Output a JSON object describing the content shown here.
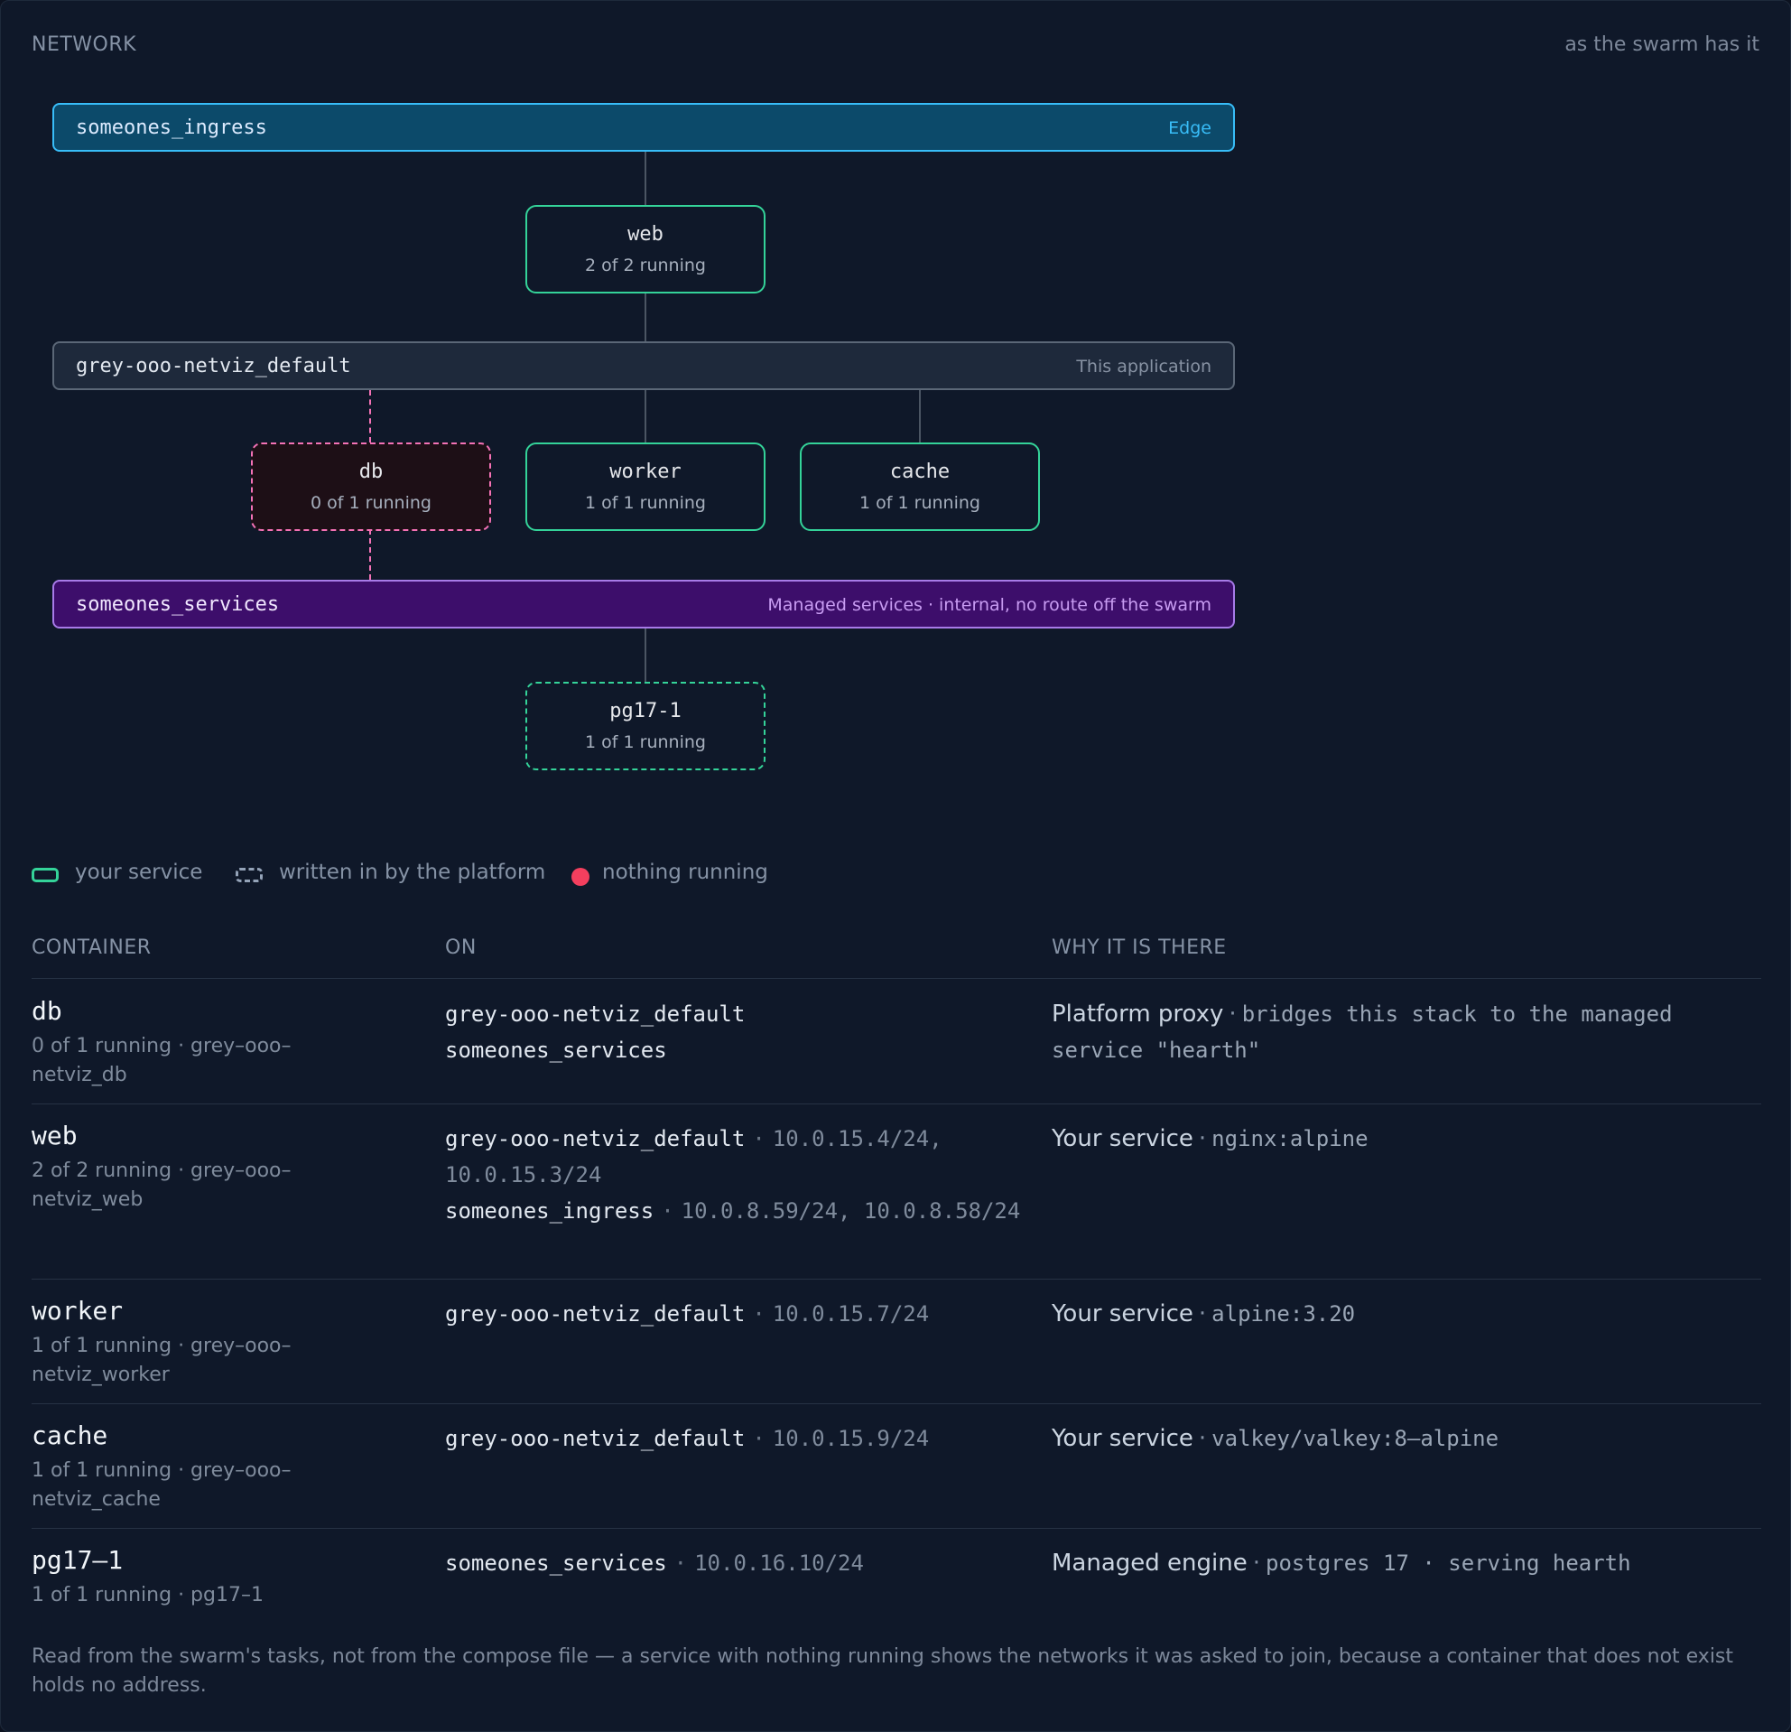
{
  "header": {
    "title": "NETWORK",
    "note": "as the swarm has it"
  },
  "networks": {
    "ingress": {
      "name": "someones_ingress",
      "tag": "Edge"
    },
    "default": {
      "name": "grey-ooo-netviz_default",
      "tag": "This application"
    },
    "services": {
      "name": "someones_services",
      "tag": "Managed services · internal, no route off the swarm"
    }
  },
  "diagram_services": {
    "web": {
      "name": "web",
      "status": "2 of 2 running"
    },
    "db": {
      "name": "db",
      "status": "0 of 1 running"
    },
    "worker": {
      "name": "worker",
      "status": "1 of 1 running"
    },
    "cache": {
      "name": "cache",
      "status": "1 of 1 running"
    },
    "pg17": {
      "name": "pg17-1",
      "status": "1 of 1 running"
    }
  },
  "legend": {
    "yours": "your service",
    "platform": "written in by the platform",
    "nothing": "nothing running"
  },
  "table": {
    "headers": {
      "container": "CONTAINER",
      "on": "ON",
      "why": "WHY IT IS THERE"
    },
    "rows": [
      {
        "name": "db",
        "sub": "0 of 1 running · grey–ooo–netviz_db",
        "on": [
          {
            "net": "grey-ooo-netviz_default",
            "sep": "",
            "ips": ""
          },
          {
            "net": "someones_services",
            "sep": "",
            "ips": ""
          }
        ],
        "why_label": "Platform proxy",
        "why_sep": "·",
        "why_detail": "bridges this stack to the managed service \"hearth\""
      },
      {
        "name": "web",
        "sub": "2 of 2 running · grey–ooo–netviz_web",
        "on": [
          {
            "net": "grey-ooo-netviz_default",
            "sep": "·",
            "ips": "10.0.15.4/24, 10.0.15.3/24"
          },
          {
            "net": "someones_ingress",
            "sep": "·",
            "ips": "10.0.8.59/24, 10.0.8.58/24"
          }
        ],
        "why_label": "Your service",
        "why_sep": "·",
        "why_detail": "nginx:alpine"
      },
      {
        "name": "worker",
        "sub": "1 of 1 running · grey–ooo–netviz_worker",
        "on": [
          {
            "net": "grey-ooo-netviz_default",
            "sep": "·",
            "ips": "10.0.15.7/24"
          }
        ],
        "why_label": "Your service",
        "why_sep": "·",
        "why_detail": "alpine:3.20"
      },
      {
        "name": "cache",
        "sub": "1 of 1 running · grey–ooo–netviz_cache",
        "on": [
          {
            "net": "grey-ooo-netviz_default",
            "sep": "·",
            "ips": "10.0.15.9/24"
          }
        ],
        "why_label": "Your service",
        "why_sep": "·",
        "why_detail": "valkey/valkey:8–alpine"
      },
      {
        "name": "pg17–1",
        "sub": "1 of 1 running · pg17–1",
        "on": [
          {
            "net": "someones_services",
            "sep": "·",
            "ips": "10.0.16.10/24"
          }
        ],
        "why_label": "Managed engine",
        "why_sep": "·",
        "why_detail": "postgres 17 · serving hearth"
      }
    ]
  },
  "footnote": "Read from the swarm's tasks, not from the compose file — a service with nothing running shows the networks it was asked to join, because a container that does not exist holds no address.",
  "colors": {
    "accent_service": "#34d399",
    "ingress": "#38bdf8",
    "services": "#a77be8",
    "down": "#f43f5e"
  }
}
